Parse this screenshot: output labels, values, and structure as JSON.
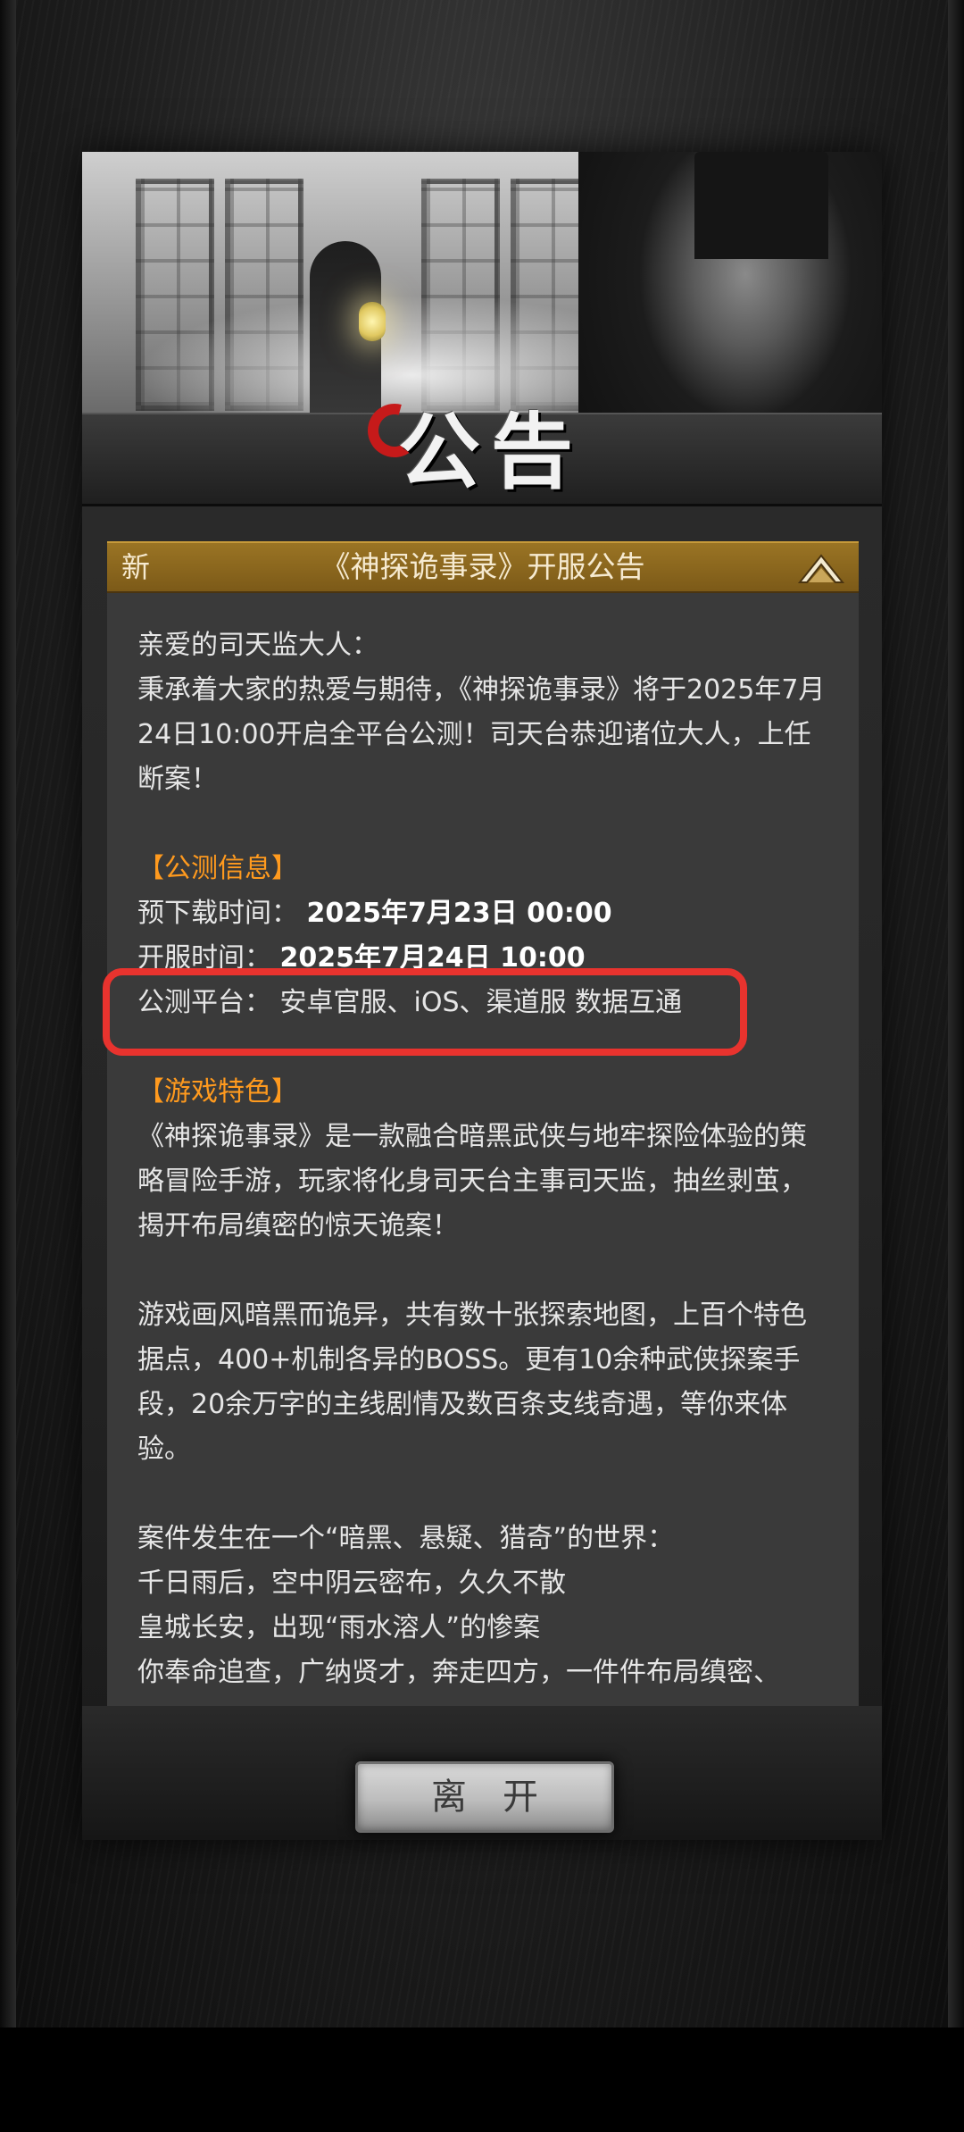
{
  "banner": {
    "title": "公告"
  },
  "notice": {
    "new_tag": "新",
    "title": "《神探诡事录》开服公告",
    "collapse_icon": "chevron-up-icon"
  },
  "content": {
    "greeting": "亲爱的司天监大人：",
    "intro": "秉承着大家的热爱与期待，《神探诡事录》将于2025年7月24日10:00开启全平台公测！司天台恭迎诸位大人，上任断案！",
    "section_info": "【公测信息】",
    "predownload_label": "预下载时间：",
    "predownload_value": "2025年7月23日 00:00",
    "open_label": "开服时间：",
    "open_value": "2025年7月24日 10:00",
    "platform_label": "公测平台：",
    "platform_value": "安卓官服、iOS、渠道服 数据互通",
    "section_features": "【游戏特色】",
    "features_p1": "《神探诡事录》是一款融合暗黑武侠与地牢探险体验的策略冒险手游，玩家将化身司天台主事司天监，抽丝剥茧，揭开布局缜密的惊天诡案！",
    "features_p2": "游戏画风暗黑而诡异，共有数十张探索地图，上百个特色据点，400+机制各异的BOSS。更有10余种武侠探案手段，20余万字的主线剧情及数百条支线奇遇，等你来体验。",
    "story_l1": "案件发生在一个“暗黑、悬疑、猎奇”的世界：",
    "story_l2": "千日雨后，空中阴云密布，久久不散",
    "story_l3": "皇城长安，出现“雨水溶人”的惨案",
    "story_l4": "你奉命追查，广纳贤才，奔走四方，一件件布局缜密、"
  },
  "footer": {
    "leave_label": "离开"
  },
  "colors": {
    "accent_orange": "#ff9a1e",
    "highlight_red": "#e8332e",
    "header_gold": "#8a6620"
  }
}
